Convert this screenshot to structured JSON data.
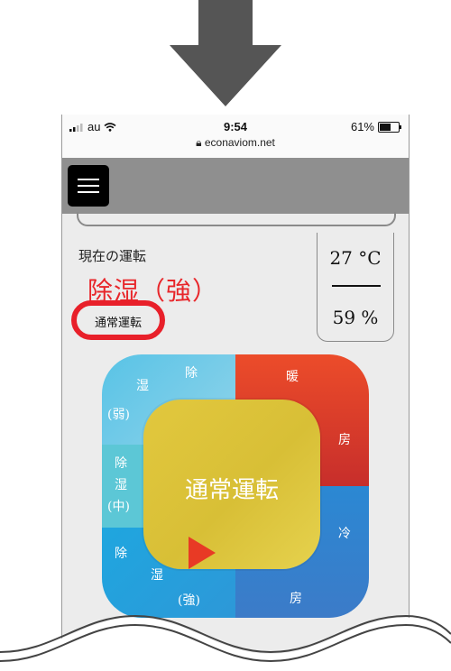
{
  "status_bar": {
    "carrier": "au",
    "time": "9:54",
    "url": "econaviom.net",
    "battery_text": "61%",
    "battery_level": 0.61
  },
  "header": {
    "menu_icon": "hamburger-menu-icon"
  },
  "current": {
    "label": "現在の運転",
    "mode": "除湿（強）",
    "sub_mode": "通常運転"
  },
  "environment": {
    "temperature": "27 °C",
    "humidity": "59 %"
  },
  "dial": {
    "center_label": "通常運転",
    "dry_weak": [
      "湿",
      "除",
      "(弱)"
    ],
    "heat": [
      "暖",
      "房"
    ],
    "dry_mid": [
      "除",
      "湿",
      "(中)"
    ],
    "cool": [
      "冷",
      "房"
    ],
    "dry_strong": [
      "除",
      "湿",
      "(強)"
    ]
  },
  "colors": {
    "accent_red": "#e8262a",
    "heat": "#d93a2a",
    "cool": "#2b88d3",
    "dry": "#58c3e6",
    "center": "#ddc53c"
  }
}
